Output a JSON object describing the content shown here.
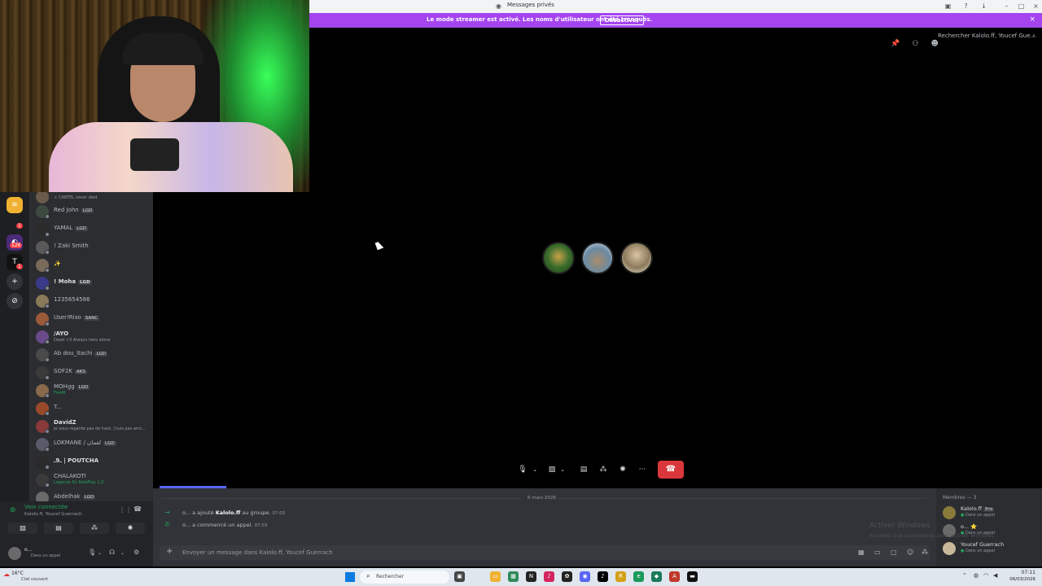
{
  "window": {
    "title": "Messages privés"
  },
  "streamer_banner": {
    "message": "Le mode streamer est activé. Les noms d'utilisateur ont été tronqués.",
    "button": "Désactiver"
  },
  "top_search": {
    "placeholder": "Rechercher Kalolo.ff, Youcef Gue..."
  },
  "servers": [
    {
      "badge": ""
    },
    {
      "badge": "1"
    },
    {
      "badge": "126"
    },
    {
      "badge": "1"
    }
  ],
  "members_list": [
    {
      "name": "",
      "sub": "⚔ CARTEL never died",
      "tag": ""
    },
    {
      "name": "Red John",
      "sub": "",
      "tag": "LGD"
    },
    {
      "name": "YAMAL",
      "sub": "",
      "tag": "LGD"
    },
    {
      "name": "! Zaki Smith",
      "sub": "",
      "tag": ""
    },
    {
      "name": "✨",
      "sub": "",
      "tag": ""
    },
    {
      "name": "! Moha",
      "sub": "",
      "tag": "LGD"
    },
    {
      "name": "1235654586",
      "sub": "",
      "tag": ""
    },
    {
      "name": "User!Rixo",
      "sub": "",
      "tag": "SANC"
    },
    {
      "name": "/AYO",
      "sub": "Dead <3 Always here alone",
      "tag": ""
    },
    {
      "name": "Ab dou_Itachi",
      "sub": "",
      "tag": "LGD"
    },
    {
      "name": "SOF2K",
      "sub": "",
      "tag": "AKS"
    },
    {
      "name": "MOHgg",
      "sub": "FiveM",
      "tag": "LGD"
    },
    {
      "name": "T...",
      "sub": "",
      "tag": ""
    },
    {
      "name": "DavidZ",
      "sub": "je vous regarde pas de haut, j'suis pas arro...",
      "tag": ""
    },
    {
      "name": "LOKMANE / لقمان",
      "sub": "",
      "tag": "LGD"
    },
    {
      "name": "ـ9ـ | POUTCHA",
      "sub": "",
      "tag": ""
    },
    {
      "name": "CHALAKOTI",
      "sub": "Legends Dz RolePlay 1.0",
      "tag": ""
    },
    {
      "name": "Abdelhak",
      "sub": "",
      "tag": "LGD"
    }
  ],
  "voice_panel": {
    "status": "Voix connectée",
    "channel": "Kalolo.ff, Youcef Guerrach"
  },
  "user_panel": {
    "name": "o...",
    "status": "Dans un appel"
  },
  "call": {
    "controls": [
      "mic",
      "camera",
      "share-screen",
      "activities",
      "soundboard",
      "more",
      "hang-up"
    ]
  },
  "chat": {
    "date": "6 mars 2026",
    "messages": [
      {
        "prefix": "o... a ajouté ",
        "bold": "Kalolo.ff",
        "suffix": " au groupe.",
        "time": "07:03"
      },
      {
        "prefix": "o... a commencé un appel.",
        "bold": "",
        "suffix": "",
        "time": "07:03"
      }
    ],
    "input_placeholder": "Envoyer un message dans Kalolo.ff, Youcef Guerrach"
  },
  "members_right": {
    "header": "Membres — 3",
    "items": [
      {
        "name": "Kalolo.ff",
        "tag": "Eris",
        "status": "Dans un appel"
      },
      {
        "name": "o... ⭐",
        "tag": "",
        "status": "Dans un appel"
      },
      {
        "name": "Youcef Guerrach",
        "tag": "",
        "status": "Dans un appel"
      }
    ]
  },
  "watermark": {
    "line1": "Activer Windows",
    "line2": "Accédez aux paramètres pour activer Windows."
  },
  "taskbar": {
    "weather_temp": "16°C",
    "weather_desc": "Ciel couvert",
    "search": "Rechercher",
    "time": "07:11",
    "date": "06/03/2026"
  },
  "colors": {
    "streamer_banner": "#a445f0",
    "hangup": "#da373c",
    "voice_connected": "#23a55a"
  }
}
